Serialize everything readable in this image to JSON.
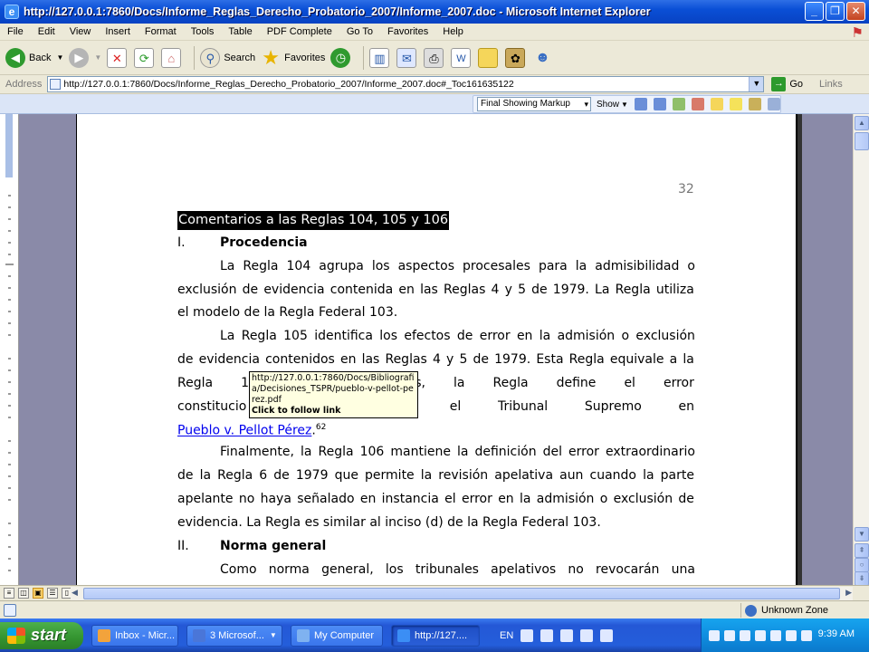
{
  "window": {
    "title": "http://127.0.0.1:7860/Docs/Informe_Reglas_Derecho_Probatorio_2007/Informe_2007.doc - Microsoft Internet Explorer",
    "minimize": "_",
    "maximize": "❐",
    "close": "✕"
  },
  "menu": [
    "File",
    "Edit",
    "View",
    "Insert",
    "Format",
    "Tools",
    "Table",
    "PDF Complete",
    "Go To",
    "Favorites",
    "Help"
  ],
  "toolbar": {
    "back_label": "Back",
    "search_label": "Search",
    "favorites_label": "Favorites"
  },
  "address": {
    "label": "Address",
    "url": "http://127.0.0.1:7860/Docs/Informe_Reglas_Derecho_Probatorio_2007/Informe_2007.doc#_Toc161635122",
    "go_label": "Go",
    "links_label": "Links"
  },
  "markup": {
    "mode": "Final Showing Markup",
    "show_label": "Show"
  },
  "document": {
    "page_number": "32",
    "heading": "Comentarios a las Reglas 104, 105 y 106",
    "section1_num": "I.",
    "section1_title": "Procedencia",
    "p1_l1": [
      "La",
      "Regla",
      "104",
      "agrupa",
      "los",
      "aspectos",
      "procesales",
      "para",
      "la",
      "admisibilidad",
      "o"
    ],
    "p1_l2": [
      "exclusión",
      "de",
      "evidencia",
      "contenida",
      "en",
      "las",
      "Reglas",
      "4",
      "y",
      "5",
      "de",
      "1979.",
      "La",
      "Regla",
      "utiliza"
    ],
    "p1_l3": "el modelo de la Regla Federal 103.",
    "p2_l1": [
      "La",
      "Regla",
      "105",
      "identifica",
      "los",
      "efectos",
      "de",
      "error",
      "en",
      "la",
      "admisión",
      "o",
      "exclusión"
    ],
    "p2_l2": [
      "de",
      "evidencia",
      "contenidos",
      "en",
      "las",
      "Reglas",
      "4",
      "y",
      "5",
      "de",
      "1979.",
      "Esta",
      "Regla",
      "equivale",
      "a",
      "la"
    ],
    "p2_l3": [
      "Regla",
      "103(",
      "ederal.",
      "Además,",
      "la",
      "Regla",
      "define",
      "el",
      "error"
    ],
    "p2_l4": [
      "constitucio",
      "jurisdicción",
      "por",
      "el",
      "Tribunal",
      "Supremo",
      "en"
    ],
    "p2_link": "Pueblo v. Pellot Pérez",
    "p2_after_link": ".",
    "footnote_ref": "62",
    "p3_l1": [
      "Finalmente,",
      "la",
      "Regla",
      "106",
      "mantiene",
      "la",
      "definición",
      "del",
      "error",
      "extraordinario"
    ],
    "p3_l2": [
      "de",
      "la",
      "Regla",
      "6",
      "de",
      "1979",
      "que",
      "permite",
      "la",
      "revisión",
      "apelativa",
      "aun",
      "cuando",
      "la",
      "parte"
    ],
    "p3_l3": [
      "apelante",
      "no",
      "haya",
      "señalado",
      "en",
      "instancia",
      "el",
      "error",
      "en",
      "la",
      "admisión",
      "o",
      "exclusión",
      "de"
    ],
    "p3_l4": "evidencia.  La Regla es similar al inciso (d) de la Regla Federal 103.",
    "section2_num": "II.",
    "section2_title": "Norma general",
    "p4_l1": [
      "Como",
      "norma",
      "general,",
      "los",
      "tribunales",
      "apelativos",
      "no",
      "revocarán",
      "una"
    ]
  },
  "tooltip": {
    "url": "http://127.0.0.1:7860/Docs/Bibliografia/Decisiones_TSPR/pueblo-v-pellot-perez.pdf",
    "action": "Click to follow link"
  },
  "status": {
    "zone": "Unknown Zone"
  },
  "taskbar": {
    "start_label": "start",
    "tasks": [
      "Inbox - Micr...",
      "3 Microsof...",
      "My Computer",
      "http://127...."
    ],
    "language": "EN",
    "clock": "9:39 AM"
  }
}
